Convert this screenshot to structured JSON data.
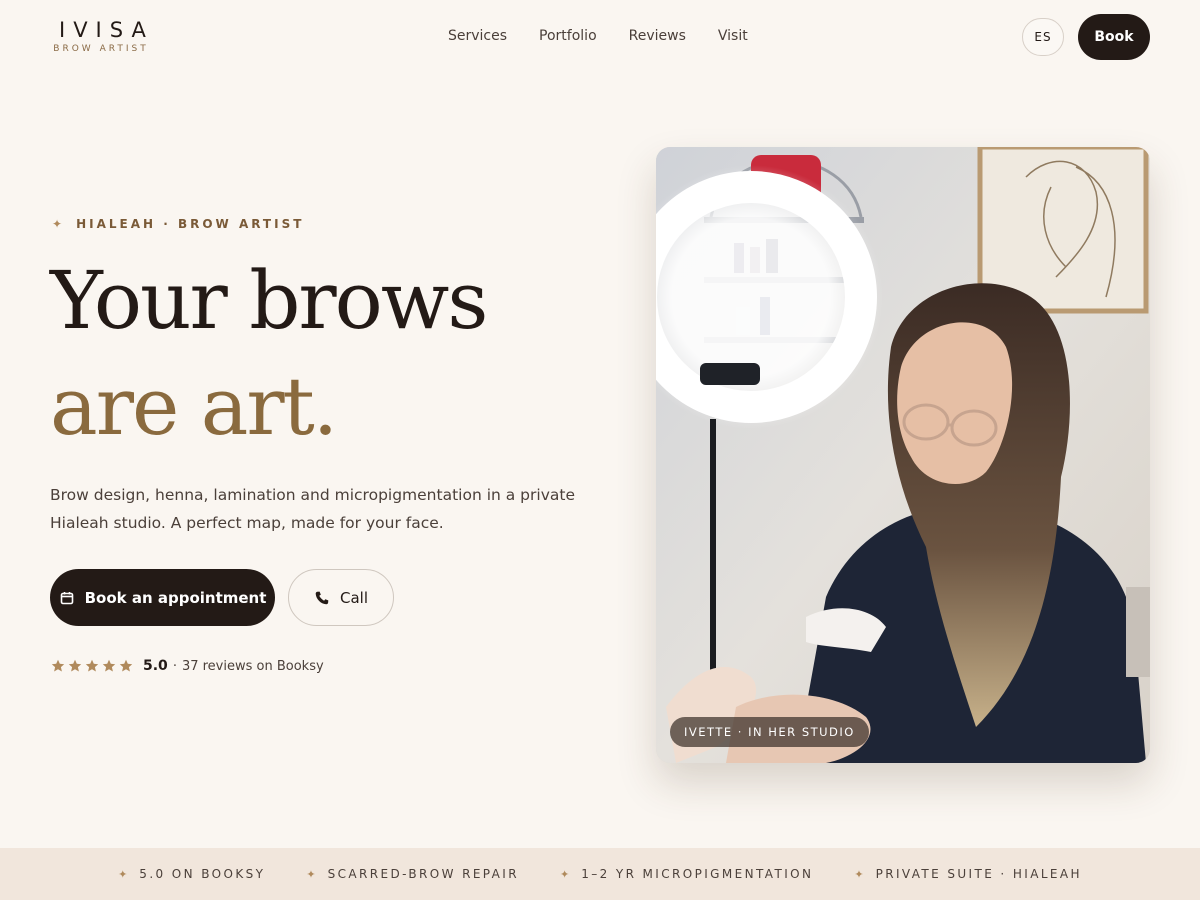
{
  "brand": {
    "name": "IVISA",
    "tagline": "BROW ARTIST"
  },
  "nav": {
    "items": [
      "Services",
      "Portfolio",
      "Reviews",
      "Visit"
    ]
  },
  "header": {
    "lang_label": "ES",
    "book_label": "Book"
  },
  "hero": {
    "eyebrow": "HIALEAH · BROW ARTIST",
    "title_line1": "Your brows",
    "title_line2": "are art.",
    "lead": "Brow design, henna, lamination and micropigmentation in a private Hialeah studio. A perfect map, made for your face.",
    "cta_primary": "Book an appointment",
    "cta_secondary": "Call",
    "rating": {
      "stars": 5,
      "score": "5.0",
      "separator": "·",
      "text": "37 reviews on Booksy"
    },
    "photo_caption": "IVETTE · IN HER STUDIO"
  },
  "strip": {
    "items": [
      "5.0 ON BOOKSY",
      "SCARRED-BROW REPAIR",
      "1–2 YR MICROPIGMENTATION",
      "PRIVATE SUITE · HIALEAH"
    ]
  },
  "colors": {
    "background": "#faf6f1",
    "ink": "#231a16",
    "accent_gold": "#8a6a3e",
    "strip_bg": "#f1e6dc",
    "star": "#b08a5c"
  },
  "icons": {
    "eyebrow": "sparkle-icon",
    "cta_primary": "calendar-icon",
    "cta_secondary": "phone-icon",
    "rating": "star-icon",
    "strip": "sparkle-icon"
  }
}
